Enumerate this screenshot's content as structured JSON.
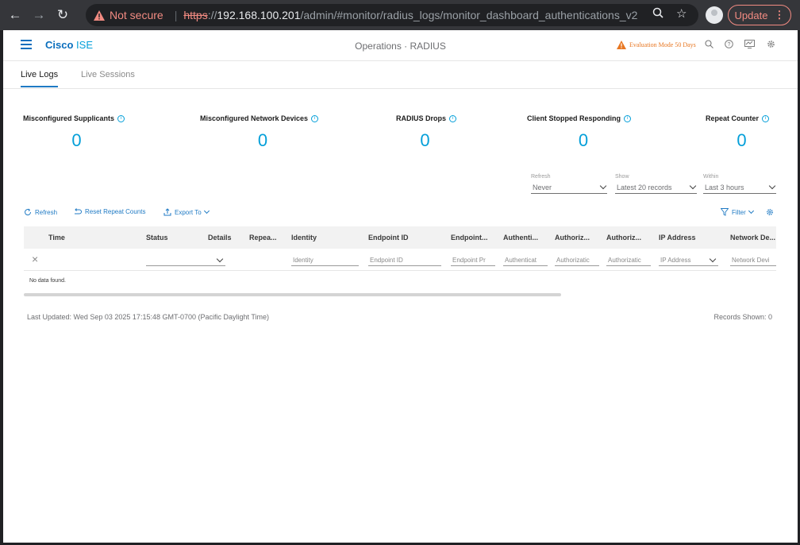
{
  "browser": {
    "security_label": "Not secure",
    "url_protocol": "https",
    "url_host": "192.168.100.201",
    "url_path": "/admin/#monitor/radius_logs/monitor_dashboard_authentications_v2",
    "update_label": "Update"
  },
  "app": {
    "brand_bold": "Cisco",
    "brand_light": "ISE",
    "title": "Operations · RADIUS",
    "eval_mode": "Evaluation Mode 50 Days"
  },
  "tabs": [
    {
      "label": "Live Logs",
      "active": true
    },
    {
      "label": "Live Sessions",
      "active": false
    }
  ],
  "counters": [
    {
      "label": "Misconfigured Supplicants",
      "value": "0"
    },
    {
      "label": "Misconfigured Network Devices",
      "value": "0"
    },
    {
      "label": "RADIUS Drops",
      "value": "0"
    },
    {
      "label": "Client Stopped Responding",
      "value": "0"
    },
    {
      "label": "Repeat Counter",
      "value": "0"
    }
  ],
  "filters": {
    "refresh": {
      "caption": "Refresh",
      "value": "Never"
    },
    "show": {
      "caption": "Show",
      "value": "Latest 20 records"
    },
    "within": {
      "caption": "Within",
      "value": "Last 3 hours"
    }
  },
  "toolbar": {
    "refresh": "Refresh",
    "reset": "Reset Repeat Counts",
    "export": "Export To",
    "filter": "Filter"
  },
  "table": {
    "columns": [
      "Time",
      "Status",
      "Details",
      "Repea...",
      "Identity",
      "Endpoint ID",
      "Endpoint...",
      "Authenti...",
      "Authoriz...",
      "Authoriz...",
      "IP Address",
      "Network De..."
    ],
    "filter_placeholders": {
      "identity": "Identity",
      "endpoint_id": "Endpoint ID",
      "endpoint_profile": "Endpoint Pr",
      "authentication": "Authenticat",
      "authz_profile": "Authorizatic",
      "authz_policy": "Authorizatic",
      "ip_address": "IP Address",
      "network_device": "Network Devi"
    },
    "empty_message": "No data found."
  },
  "footer": {
    "last_updated": "Last Updated: Wed Sep 03 2025 17:15:48 GMT-0700 (Pacific Daylight Time)",
    "records_shown": "Records Shown: 0"
  },
  "colors": {
    "accent": "#049fd9",
    "brand": "#0a6ebd",
    "warning": "#e87722"
  }
}
